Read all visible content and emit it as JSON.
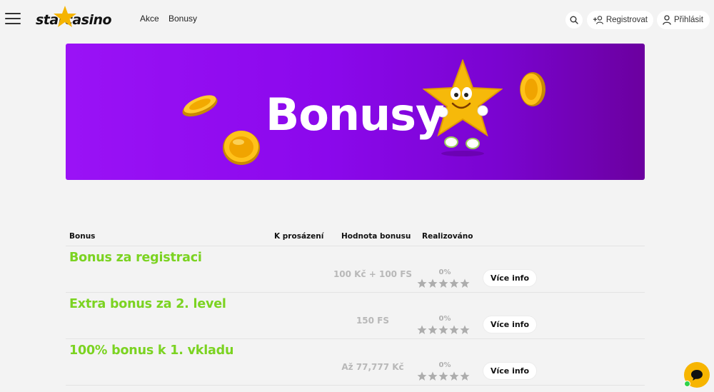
{
  "header": {
    "menu_icon": "hamburger-menu-icon",
    "logo": {
      "text": "starcasino",
      "icon": "star-icon",
      "color_star": "#f5b400"
    },
    "nav": [
      {
        "label": "Akce"
      },
      {
        "label": "Bonusy"
      }
    ],
    "search_icon": "search-icon",
    "register_label": "Registrovat",
    "register_icon": "add-user-icon",
    "login_label": "Přihlásit",
    "login_icon": "user-icon"
  },
  "hero": {
    "title": "Bonusy",
    "background_color": "#8b08ec",
    "decor": [
      "gold-coin-icon",
      "star-mascot-icon"
    ]
  },
  "table": {
    "columns": [
      "Bonus",
      "K prosázení",
      "Hodnota bonusu",
      "Realizováno"
    ],
    "rows": [
      {
        "title": "Bonus za registraci",
        "rollover": "",
        "value": "100 Kč + 100 FS",
        "realized": "0%",
        "stars": 0,
        "action": "Více info"
      },
      {
        "title": "Extra bonus za 2. level",
        "rollover": "",
        "value": "150 FS",
        "realized": "0%",
        "stars": 0,
        "action": "Více info"
      },
      {
        "title": "100% bonus k 1. vkladu",
        "rollover": "",
        "value": "Až 77,777 Kč",
        "realized": "0%",
        "stars": 0,
        "action": "Více info"
      }
    ]
  },
  "colors": {
    "accent_green": "#7bd321",
    "hero_purple": "#8b08ec",
    "chat_yellow": "#f7b500",
    "online_green": "#2fd24a"
  },
  "chat": {
    "icon": "chat-bubble-icon",
    "status_icon": "online-status-icon"
  }
}
